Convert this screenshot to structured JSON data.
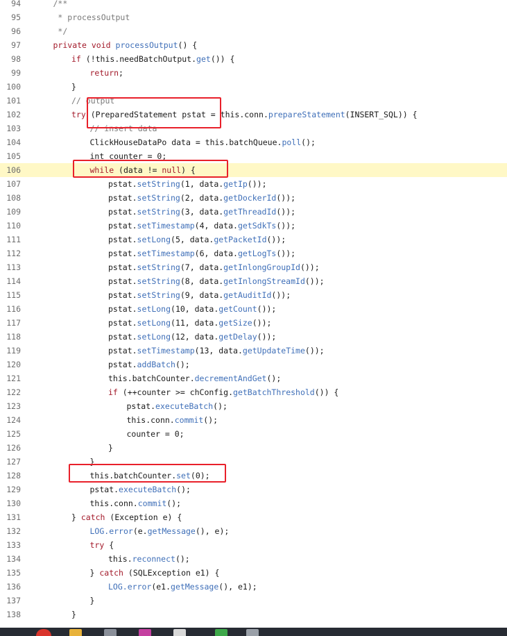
{
  "editor": {
    "highlighted_line": 106,
    "lines": [
      {
        "n": "94",
        "indent": 1,
        "tokens": [
          {
            "t": "/**",
            "c": "cm"
          }
        ]
      },
      {
        "n": "95",
        "indent": 1,
        "tokens": [
          {
            "t": " * processOutput",
            "c": "cm"
          }
        ]
      },
      {
        "n": "96",
        "indent": 1,
        "tokens": [
          {
            "t": " */",
            "c": "cm"
          }
        ]
      },
      {
        "n": "97",
        "indent": 1,
        "tokens": [
          {
            "t": "private void ",
            "c": "kw"
          },
          {
            "t": "processOutput",
            "c": "fn"
          },
          {
            "t": "() {",
            "c": ""
          }
        ]
      },
      {
        "n": "98",
        "indent": 2,
        "tokens": [
          {
            "t": "if ",
            "c": "kw"
          },
          {
            "t": "(!this.needBatchOutput.",
            "c": ""
          },
          {
            "t": "get",
            "c": "fn"
          },
          {
            "t": "()) {",
            "c": ""
          }
        ]
      },
      {
        "n": "99",
        "indent": 3,
        "tokens": [
          {
            "t": "return",
            "c": "kw"
          },
          {
            "t": ";",
            "c": ""
          }
        ]
      },
      {
        "n": "100",
        "indent": 2,
        "tokens": [
          {
            "t": "}",
            "c": ""
          }
        ]
      },
      {
        "n": "101",
        "indent": 2,
        "tokens": [
          {
            "t": "// output",
            "c": "cm"
          }
        ]
      },
      {
        "n": "102",
        "indent": 2,
        "tokens": [
          {
            "t": "try ",
            "c": "kw"
          },
          {
            "t": "(PreparedStatement pstat = this.conn.",
            "c": ""
          },
          {
            "t": "prepareStatement",
            "c": "fn"
          },
          {
            "t": "(INSERT_SQL)) {",
            "c": ""
          }
        ]
      },
      {
        "n": "103",
        "indent": 3,
        "tokens": [
          {
            "t": "// insert data",
            "c": "cm"
          }
        ]
      },
      {
        "n": "104",
        "indent": 3,
        "tokens": [
          {
            "t": "ClickHouseDataPo data = this.batchQueue.",
            "c": ""
          },
          {
            "t": "poll",
            "c": "fn"
          },
          {
            "t": "();",
            "c": ""
          }
        ]
      },
      {
        "n": "105",
        "indent": 3,
        "tokens": [
          {
            "t": "int counter = 0;",
            "c": ""
          }
        ]
      },
      {
        "n": "106",
        "indent": 3,
        "tokens": [
          {
            "t": "while ",
            "c": "kw"
          },
          {
            "t": "(data != ",
            "c": ""
          },
          {
            "t": "null",
            "c": "kw"
          },
          {
            "t": ") {",
            "c": ""
          }
        ]
      },
      {
        "n": "107",
        "indent": 4,
        "tokens": [
          {
            "t": "pstat.",
            "c": ""
          },
          {
            "t": "setString",
            "c": "fn"
          },
          {
            "t": "(1, data.",
            "c": ""
          },
          {
            "t": "getIp",
            "c": "fn"
          },
          {
            "t": "());",
            "c": ""
          }
        ]
      },
      {
        "n": "108",
        "indent": 4,
        "tokens": [
          {
            "t": "pstat.",
            "c": ""
          },
          {
            "t": "setString",
            "c": "fn"
          },
          {
            "t": "(2, data.",
            "c": ""
          },
          {
            "t": "getDockerId",
            "c": "fn"
          },
          {
            "t": "());",
            "c": ""
          }
        ]
      },
      {
        "n": "109",
        "indent": 4,
        "tokens": [
          {
            "t": "pstat.",
            "c": ""
          },
          {
            "t": "setString",
            "c": "fn"
          },
          {
            "t": "(3, data.",
            "c": ""
          },
          {
            "t": "getThreadId",
            "c": "fn"
          },
          {
            "t": "());",
            "c": ""
          }
        ]
      },
      {
        "n": "110",
        "indent": 4,
        "tokens": [
          {
            "t": "pstat.",
            "c": ""
          },
          {
            "t": "setTimestamp",
            "c": "fn"
          },
          {
            "t": "(4, data.",
            "c": ""
          },
          {
            "t": "getSdkTs",
            "c": "fn"
          },
          {
            "t": "());",
            "c": ""
          }
        ]
      },
      {
        "n": "111",
        "indent": 4,
        "tokens": [
          {
            "t": "pstat.",
            "c": ""
          },
          {
            "t": "setLong",
            "c": "fn"
          },
          {
            "t": "(5, data.",
            "c": ""
          },
          {
            "t": "getPacketId",
            "c": "fn"
          },
          {
            "t": "());",
            "c": ""
          }
        ]
      },
      {
        "n": "112",
        "indent": 4,
        "tokens": [
          {
            "t": "pstat.",
            "c": ""
          },
          {
            "t": "setTimestamp",
            "c": "fn"
          },
          {
            "t": "(6, data.",
            "c": ""
          },
          {
            "t": "getLogTs",
            "c": "fn"
          },
          {
            "t": "());",
            "c": ""
          }
        ]
      },
      {
        "n": "113",
        "indent": 4,
        "tokens": [
          {
            "t": "pstat.",
            "c": ""
          },
          {
            "t": "setString",
            "c": "fn"
          },
          {
            "t": "(7, data.",
            "c": ""
          },
          {
            "t": "getInlongGroupId",
            "c": "fn"
          },
          {
            "t": "());",
            "c": ""
          }
        ]
      },
      {
        "n": "114",
        "indent": 4,
        "tokens": [
          {
            "t": "pstat.",
            "c": ""
          },
          {
            "t": "setString",
            "c": "fn"
          },
          {
            "t": "(8, data.",
            "c": ""
          },
          {
            "t": "getInlongStreamId",
            "c": "fn"
          },
          {
            "t": "());",
            "c": ""
          }
        ]
      },
      {
        "n": "115",
        "indent": 4,
        "tokens": [
          {
            "t": "pstat.",
            "c": ""
          },
          {
            "t": "setString",
            "c": "fn"
          },
          {
            "t": "(9, data.",
            "c": ""
          },
          {
            "t": "getAuditId",
            "c": "fn"
          },
          {
            "t": "());",
            "c": ""
          }
        ]
      },
      {
        "n": "116",
        "indent": 4,
        "tokens": [
          {
            "t": "pstat.",
            "c": ""
          },
          {
            "t": "setLong",
            "c": "fn"
          },
          {
            "t": "(10, data.",
            "c": ""
          },
          {
            "t": "getCount",
            "c": "fn"
          },
          {
            "t": "());",
            "c": ""
          }
        ]
      },
      {
        "n": "117",
        "indent": 4,
        "tokens": [
          {
            "t": "pstat.",
            "c": ""
          },
          {
            "t": "setLong",
            "c": "fn"
          },
          {
            "t": "(11, data.",
            "c": ""
          },
          {
            "t": "getSize",
            "c": "fn"
          },
          {
            "t": "());",
            "c": ""
          }
        ]
      },
      {
        "n": "118",
        "indent": 4,
        "tokens": [
          {
            "t": "pstat.",
            "c": ""
          },
          {
            "t": "setLong",
            "c": "fn"
          },
          {
            "t": "(12, data.",
            "c": ""
          },
          {
            "t": "getDelay",
            "c": "fn"
          },
          {
            "t": "());",
            "c": ""
          }
        ]
      },
      {
        "n": "119",
        "indent": 4,
        "tokens": [
          {
            "t": "pstat.",
            "c": ""
          },
          {
            "t": "setTimestamp",
            "c": "fn"
          },
          {
            "t": "(13, data.",
            "c": ""
          },
          {
            "t": "getUpdateTime",
            "c": "fn"
          },
          {
            "t": "());",
            "c": ""
          }
        ]
      },
      {
        "n": "120",
        "indent": 4,
        "tokens": [
          {
            "t": "pstat.",
            "c": ""
          },
          {
            "t": "addBatch",
            "c": "fn"
          },
          {
            "t": "();",
            "c": ""
          }
        ]
      },
      {
        "n": "121",
        "indent": 4,
        "tokens": [
          {
            "t": "this.batchCounter.",
            "c": ""
          },
          {
            "t": "decrementAndGet",
            "c": "fn"
          },
          {
            "t": "();",
            "c": ""
          }
        ]
      },
      {
        "n": "122",
        "indent": 4,
        "tokens": [
          {
            "t": "if ",
            "c": "kw"
          },
          {
            "t": "(++counter >= chConfig.",
            "c": ""
          },
          {
            "t": "getBatchThreshold",
            "c": "fn"
          },
          {
            "t": "()) {",
            "c": ""
          }
        ]
      },
      {
        "n": "123",
        "indent": 5,
        "tokens": [
          {
            "t": "pstat.",
            "c": ""
          },
          {
            "t": "executeBatch",
            "c": "fn"
          },
          {
            "t": "();",
            "c": ""
          }
        ]
      },
      {
        "n": "124",
        "indent": 5,
        "tokens": [
          {
            "t": "this.conn.",
            "c": ""
          },
          {
            "t": "commit",
            "c": "fn"
          },
          {
            "t": "();",
            "c": ""
          }
        ]
      },
      {
        "n": "125",
        "indent": 5,
        "tokens": [
          {
            "t": "counter = 0;",
            "c": ""
          }
        ]
      },
      {
        "n": "126",
        "indent": 4,
        "tokens": [
          {
            "t": "}",
            "c": ""
          }
        ]
      },
      {
        "n": "127",
        "indent": 3,
        "tokens": [
          {
            "t": "}",
            "c": ""
          }
        ]
      },
      {
        "n": "128",
        "indent": 3,
        "tokens": [
          {
            "t": "this.batchCounter.",
            "c": ""
          },
          {
            "t": "set",
            "c": "fn"
          },
          {
            "t": "(0);",
            "c": ""
          }
        ]
      },
      {
        "n": "129",
        "indent": 3,
        "tokens": [
          {
            "t": "pstat.",
            "c": ""
          },
          {
            "t": "executeBatch",
            "c": "fn"
          },
          {
            "t": "();",
            "c": ""
          }
        ]
      },
      {
        "n": "130",
        "indent": 3,
        "tokens": [
          {
            "t": "this.conn.",
            "c": ""
          },
          {
            "t": "commit",
            "c": "fn"
          },
          {
            "t": "();",
            "c": ""
          }
        ]
      },
      {
        "n": "131",
        "indent": 2,
        "tokens": [
          {
            "t": "} ",
            "c": ""
          },
          {
            "t": "catch ",
            "c": "kw"
          },
          {
            "t": "(Exception e) {",
            "c": ""
          }
        ]
      },
      {
        "n": "132",
        "indent": 3,
        "tokens": [
          {
            "t": "LOG.",
            "c": "fn"
          },
          {
            "t": "error",
            "c": "fn"
          },
          {
            "t": "(e.",
            "c": ""
          },
          {
            "t": "getMessage",
            "c": "fn"
          },
          {
            "t": "(), e);",
            "c": ""
          }
        ]
      },
      {
        "n": "133",
        "indent": 3,
        "tokens": [
          {
            "t": "try ",
            "c": "kw"
          },
          {
            "t": "{",
            "c": ""
          }
        ]
      },
      {
        "n": "134",
        "indent": 4,
        "tokens": [
          {
            "t": "this.",
            "c": ""
          },
          {
            "t": "reconnect",
            "c": "fn"
          },
          {
            "t": "();",
            "c": ""
          }
        ]
      },
      {
        "n": "135",
        "indent": 3,
        "tokens": [
          {
            "t": "} ",
            "c": ""
          },
          {
            "t": "catch ",
            "c": "kw"
          },
          {
            "t": "(SQLException e1) {",
            "c": ""
          }
        ]
      },
      {
        "n": "136",
        "indent": 4,
        "tokens": [
          {
            "t": "LOG.",
            "c": "fn"
          },
          {
            "t": "error",
            "c": "fn"
          },
          {
            "t": "(e1.",
            "c": ""
          },
          {
            "t": "getMessage",
            "c": "fn"
          },
          {
            "t": "(), e1);",
            "c": ""
          }
        ]
      },
      {
        "n": "137",
        "indent": 3,
        "tokens": [
          {
            "t": "}",
            "c": ""
          }
        ]
      },
      {
        "n": "138",
        "indent": 2,
        "tokens": [
          {
            "t": "}",
            "c": ""
          }
        ]
      }
    ]
  },
  "annotations": [
    {
      "name": "annotation-box-try-prepared-statement",
      "color": "#e8202a"
    },
    {
      "name": "annotation-box-while-loop",
      "color": "#e8202a"
    },
    {
      "name": "annotation-box-batch-counter-set",
      "color": "#e8202a"
    }
  ],
  "taskbar": {
    "icons": [
      {
        "name": "browser-icon",
        "color": "#d9342b"
      },
      {
        "name": "folder-icon",
        "color": "#e8b23a"
      },
      {
        "name": "window-app-icon",
        "color": "#8a8f99"
      },
      {
        "name": "colorful-app-icon",
        "color": "#c43fa0"
      },
      {
        "name": "document-app-icon",
        "color": "#d8d8d8"
      },
      {
        "name": "green-app-icon",
        "color": "#3ea84a"
      },
      {
        "name": "file-app-icon",
        "color": "#9aa0a8"
      }
    ]
  }
}
